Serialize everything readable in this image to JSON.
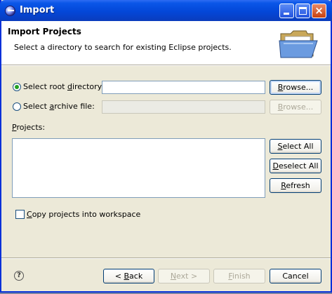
{
  "window": {
    "title": "Import"
  },
  "header": {
    "title": "Import Projects",
    "description": "Select a directory to search for existing Eclipse projects."
  },
  "source": {
    "root_directory": {
      "label_pre": "Select root ",
      "label_u": "d",
      "label_post": "irectory:",
      "selected": true,
      "value": ""
    },
    "archive_file": {
      "label_pre": "Select ",
      "label_u": "a",
      "label_post": "rchive file:",
      "selected": false,
      "value": ""
    },
    "browse_label_pre": "",
    "browse_u": "B",
    "browse_post": "rowse..."
  },
  "projects": {
    "label_u": "P",
    "label_post": "rojects:",
    "items": [],
    "select_all": {
      "u": "S",
      "post": "elect All"
    },
    "deselect_all": {
      "u": "D",
      "post": "eselect All"
    },
    "refresh": {
      "u": "R",
      "post": "efresh"
    }
  },
  "copy_option": {
    "u": "C",
    "post": "opy projects into workspace",
    "checked": false
  },
  "footer": {
    "help": "?",
    "back_pre": "< ",
    "back_u": "B",
    "back_post": "ack",
    "next_u": "N",
    "next_post": "ext >",
    "finish_u": "F",
    "finish_post": "inish",
    "cancel": "Cancel"
  }
}
